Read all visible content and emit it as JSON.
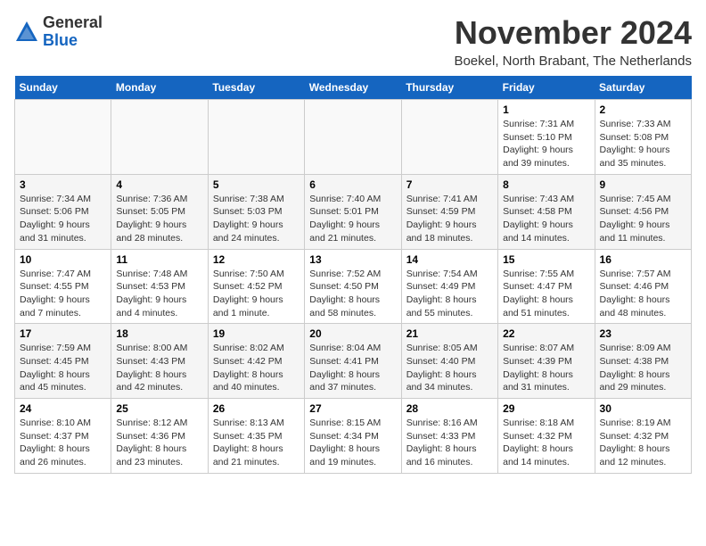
{
  "header": {
    "logo_general": "General",
    "logo_blue": "Blue",
    "month_title": "November 2024",
    "subtitle": "Boekel, North Brabant, The Netherlands"
  },
  "weekdays": [
    "Sunday",
    "Monday",
    "Tuesday",
    "Wednesday",
    "Thursday",
    "Friday",
    "Saturday"
  ],
  "weeks": [
    [
      {
        "day": "",
        "info": ""
      },
      {
        "day": "",
        "info": ""
      },
      {
        "day": "",
        "info": ""
      },
      {
        "day": "",
        "info": ""
      },
      {
        "day": "",
        "info": ""
      },
      {
        "day": "1",
        "info": "Sunrise: 7:31 AM\nSunset: 5:10 PM\nDaylight: 9 hours and 39 minutes."
      },
      {
        "day": "2",
        "info": "Sunrise: 7:33 AM\nSunset: 5:08 PM\nDaylight: 9 hours and 35 minutes."
      }
    ],
    [
      {
        "day": "3",
        "info": "Sunrise: 7:34 AM\nSunset: 5:06 PM\nDaylight: 9 hours and 31 minutes."
      },
      {
        "day": "4",
        "info": "Sunrise: 7:36 AM\nSunset: 5:05 PM\nDaylight: 9 hours and 28 minutes."
      },
      {
        "day": "5",
        "info": "Sunrise: 7:38 AM\nSunset: 5:03 PM\nDaylight: 9 hours and 24 minutes."
      },
      {
        "day": "6",
        "info": "Sunrise: 7:40 AM\nSunset: 5:01 PM\nDaylight: 9 hours and 21 minutes."
      },
      {
        "day": "7",
        "info": "Sunrise: 7:41 AM\nSunset: 4:59 PM\nDaylight: 9 hours and 18 minutes."
      },
      {
        "day": "8",
        "info": "Sunrise: 7:43 AM\nSunset: 4:58 PM\nDaylight: 9 hours and 14 minutes."
      },
      {
        "day": "9",
        "info": "Sunrise: 7:45 AM\nSunset: 4:56 PM\nDaylight: 9 hours and 11 minutes."
      }
    ],
    [
      {
        "day": "10",
        "info": "Sunrise: 7:47 AM\nSunset: 4:55 PM\nDaylight: 9 hours and 7 minutes."
      },
      {
        "day": "11",
        "info": "Sunrise: 7:48 AM\nSunset: 4:53 PM\nDaylight: 9 hours and 4 minutes."
      },
      {
        "day": "12",
        "info": "Sunrise: 7:50 AM\nSunset: 4:52 PM\nDaylight: 9 hours and 1 minute."
      },
      {
        "day": "13",
        "info": "Sunrise: 7:52 AM\nSunset: 4:50 PM\nDaylight: 8 hours and 58 minutes."
      },
      {
        "day": "14",
        "info": "Sunrise: 7:54 AM\nSunset: 4:49 PM\nDaylight: 8 hours and 55 minutes."
      },
      {
        "day": "15",
        "info": "Sunrise: 7:55 AM\nSunset: 4:47 PM\nDaylight: 8 hours and 51 minutes."
      },
      {
        "day": "16",
        "info": "Sunrise: 7:57 AM\nSunset: 4:46 PM\nDaylight: 8 hours and 48 minutes."
      }
    ],
    [
      {
        "day": "17",
        "info": "Sunrise: 7:59 AM\nSunset: 4:45 PM\nDaylight: 8 hours and 45 minutes."
      },
      {
        "day": "18",
        "info": "Sunrise: 8:00 AM\nSunset: 4:43 PM\nDaylight: 8 hours and 42 minutes."
      },
      {
        "day": "19",
        "info": "Sunrise: 8:02 AM\nSunset: 4:42 PM\nDaylight: 8 hours and 40 minutes."
      },
      {
        "day": "20",
        "info": "Sunrise: 8:04 AM\nSunset: 4:41 PM\nDaylight: 8 hours and 37 minutes."
      },
      {
        "day": "21",
        "info": "Sunrise: 8:05 AM\nSunset: 4:40 PM\nDaylight: 8 hours and 34 minutes."
      },
      {
        "day": "22",
        "info": "Sunrise: 8:07 AM\nSunset: 4:39 PM\nDaylight: 8 hours and 31 minutes."
      },
      {
        "day": "23",
        "info": "Sunrise: 8:09 AM\nSunset: 4:38 PM\nDaylight: 8 hours and 29 minutes."
      }
    ],
    [
      {
        "day": "24",
        "info": "Sunrise: 8:10 AM\nSunset: 4:37 PM\nDaylight: 8 hours and 26 minutes."
      },
      {
        "day": "25",
        "info": "Sunrise: 8:12 AM\nSunset: 4:36 PM\nDaylight: 8 hours and 23 minutes."
      },
      {
        "day": "26",
        "info": "Sunrise: 8:13 AM\nSunset: 4:35 PM\nDaylight: 8 hours and 21 minutes."
      },
      {
        "day": "27",
        "info": "Sunrise: 8:15 AM\nSunset: 4:34 PM\nDaylight: 8 hours and 19 minutes."
      },
      {
        "day": "28",
        "info": "Sunrise: 8:16 AM\nSunset: 4:33 PM\nDaylight: 8 hours and 16 minutes."
      },
      {
        "day": "29",
        "info": "Sunrise: 8:18 AM\nSunset: 4:32 PM\nDaylight: 8 hours and 14 minutes."
      },
      {
        "day": "30",
        "info": "Sunrise: 8:19 AM\nSunset: 4:32 PM\nDaylight: 8 hours and 12 minutes."
      }
    ]
  ]
}
